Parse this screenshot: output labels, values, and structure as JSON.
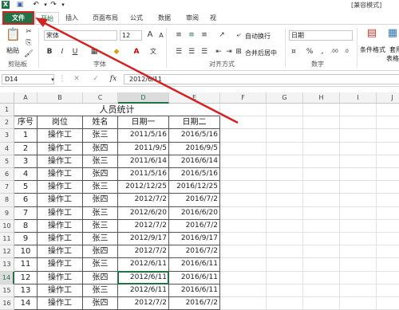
{
  "titlebar": {
    "title": "[兼容模式]"
  },
  "tabs": [
    "文件",
    "开始",
    "插入",
    "页面布局",
    "公式",
    "数据",
    "审阅",
    "视"
  ],
  "ribbon": {
    "paste_label": "粘贴",
    "clipboard_label": "剪贴板",
    "font_name": "宋体",
    "font_size": "12",
    "font_group_label": "字体",
    "wrap_text_label": "自动换行",
    "merge_center_label": "合并后居中",
    "alignment_label": "对齐方式",
    "number_format": "日期",
    "number_label": "数字",
    "conditional_format_label": "条件格式",
    "table_format_label_1": "套用",
    "table_format_label_2": "表格格"
  },
  "formula_bar": {
    "cell_ref": "D14",
    "fx": "fx",
    "value": "2012/6/11"
  },
  "columns": [
    "A",
    "B",
    "C",
    "D",
    "E",
    "F",
    "G",
    "H",
    "I",
    "J"
  ],
  "sheet": {
    "title": "人员统计",
    "headers": [
      "序号",
      "岗位",
      "姓名",
      "日期一",
      "日期二"
    ],
    "rows": [
      [
        "1",
        "操作工",
        "张三",
        "2011/5/16",
        "2016/5/16"
      ],
      [
        "2",
        "操作工",
        "张四",
        "2011/9/5",
        "2016/9/5"
      ],
      [
        "3",
        "操作工",
        "张三",
        "2011/6/14",
        "2016/6/14"
      ],
      [
        "4",
        "操作工",
        "张四",
        "2011/5/16",
        "2016/5/16"
      ],
      [
        "5",
        "操作工",
        "张三",
        "2012/12/25",
        "2016/12/25"
      ],
      [
        "6",
        "操作工",
        "张四",
        "2012/7/2",
        "2016/7/2"
      ],
      [
        "7",
        "操作工",
        "张三",
        "2012/6/20",
        "2016/6/20"
      ],
      [
        "8",
        "操作工",
        "张三",
        "2012/7/2",
        "2016/7/2"
      ],
      [
        "9",
        "操作工",
        "张三",
        "2012/9/17",
        "2016/9/17"
      ],
      [
        "10",
        "操作工",
        "张四",
        "2012/7/2",
        "2016/7/2"
      ],
      [
        "11",
        "操作工",
        "张三",
        "2012/6/11",
        "2016/6/11"
      ],
      [
        "12",
        "操作工",
        "张四",
        "2012/6/11",
        "2016/6/11"
      ],
      [
        "13",
        "操作工",
        "张三",
        "2012/6/11",
        "2016/6/11"
      ],
      [
        "14",
        "操作工",
        "张四",
        "2012/7/2",
        "2016/7/2"
      ]
    ]
  },
  "colors": {
    "excel_green": "#217346",
    "arrow_red": "#d32222"
  }
}
